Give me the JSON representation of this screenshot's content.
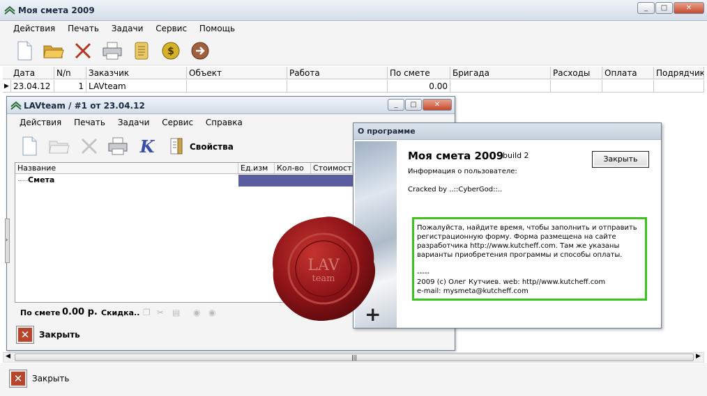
{
  "main_window": {
    "title": "Моя смета 2009",
    "menu": [
      "Действия",
      "Печать",
      "Задачи",
      "Сервис",
      "Помощь"
    ],
    "toolbar_icons": [
      "new-document-icon",
      "open-folder-icon",
      "delete-x-icon",
      "printer-icon",
      "scroll-report-icon",
      "dollar-coin-icon",
      "arrow-right-icon"
    ],
    "table": {
      "columns": [
        "Дата",
        "N/n",
        "Заказчик",
        "Объект",
        "Работа",
        "По смете",
        "Бригада",
        "Расходы",
        "Оплата",
        "Подрядчик"
      ],
      "rows": [
        {
          "date": "23.04.12",
          "num": "1",
          "customer": "LAVteam",
          "object": "",
          "work": "",
          "by_estimate": "0.00",
          "brigade": "",
          "expenses": "",
          "payment": "",
          "contractor": ""
        }
      ]
    },
    "close_label": "Закрыть"
  },
  "child_window": {
    "title": "LAVteam / #1 от 23.04.12",
    "menu": [
      "Действия",
      "Печать",
      "Задачи",
      "Сервис",
      "Справка"
    ],
    "properties_label": "Свойства",
    "table": {
      "columns": [
        "Название",
        "Ед.изм",
        "Кол-во",
        "Стоимость"
      ],
      "rows": [
        {
          "name": "Смета"
        }
      ]
    },
    "footer": {
      "by_estimate_label": "По смете",
      "amount": "0.00 р.",
      "discount_label": "Скидка.."
    },
    "close_label": "Закрыть"
  },
  "about_dialog": {
    "title": "О программе",
    "app_name": "Моя смета 2009",
    "build": "build 2",
    "user_info": "Информация о пользователе:",
    "cracked": "Cracked by ..::CyberGod::..",
    "close_label": "Закрыть",
    "message": "Пожалуйста, найдите время, чтобы заполнить и отправить регистрационную форму. Форма размещена на сайте разработчика http://www.kutcheff.com. Там же указаны варианты приобретения программы и способы оплаты.",
    "separator": "-----",
    "copyright": "2009 (c) Олег Кутчиев. web: http//www.kutcheff.com",
    "email": "e-mail: mysmeta@kutcheff.com"
  },
  "colors": {
    "border_green": "#3bc31e",
    "seal_red": "#8f1418",
    "selection": "#5a5ea0"
  }
}
